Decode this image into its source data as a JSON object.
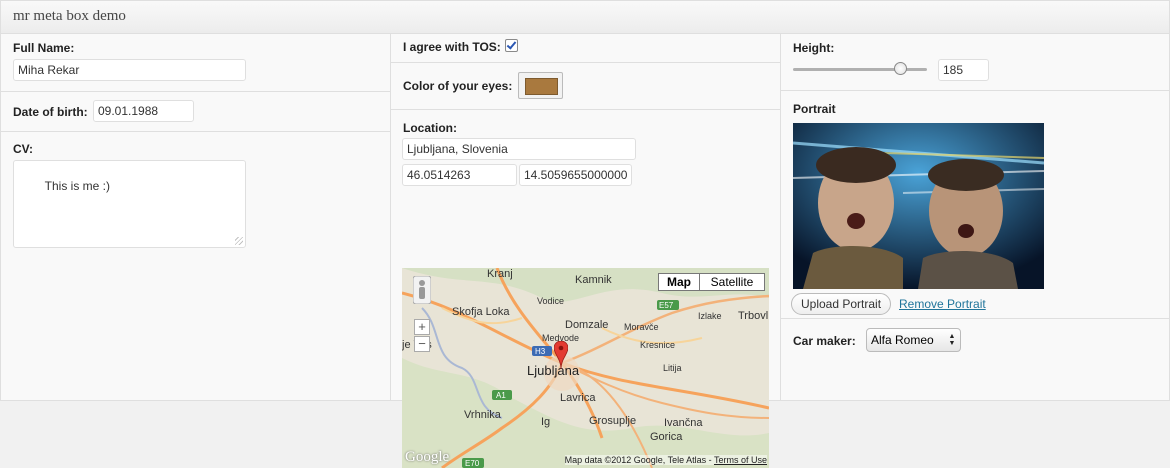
{
  "title": "mr meta box demo",
  "col1": {
    "full_name_label": "Full Name:",
    "full_name_value": "Miha Rekar",
    "dob_label": "Date of birth:",
    "dob_value": "09.01.1988",
    "cv_label": "CV:",
    "cv_value": "This is me :)"
  },
  "col2": {
    "tos_label": "I agree with TOS:",
    "tos_checked": true,
    "eyes_label": "Color of your eyes:",
    "eyes_color": "#a9793e",
    "location_label": "Location:",
    "location_value": "Ljubljana, Slovenia",
    "lat_value": "46.0514263",
    "lng_value": "14.5059655000000",
    "map": {
      "map_button": "Map",
      "satellite_button": "Satellite",
      "zoom_in": "+",
      "zoom_out": "−",
      "attribution": "Map data ©2012 Google, Tele Atlas - ",
      "terms": "Terms of Use",
      "google_logo": "Google",
      "places": {
        "kranj": "Kranj",
        "kamnik": "Kamnik",
        "vodice": "Vodice",
        "skofja": "Skofja Loka",
        "domzale": "Domzale",
        "izlake": "Izlake",
        "trbovlje": "Trbovl",
        "moravce": "Moravče",
        "medvode": "Medvode",
        "polhov": "je Vas",
        "kresnice": "Kresnice",
        "ljubljana": "Ljubljana",
        "litija": "Litija",
        "lavrica": "Lavrica",
        "vrhnika": "Vrhnika",
        "ig": "Ig",
        "grosuplje": "Grosuplje",
        "ivancna": "Ivančna",
        "gorica": "Gorica"
      },
      "shields": {
        "e57": "E57",
        "h3": "H3",
        "a1": "A1",
        "e70": "E70"
      }
    }
  },
  "col3": {
    "height_label": "Height:",
    "height_value": "185",
    "height_fraction": 0.8,
    "portrait_label": "Portrait",
    "upload_button": "Upload Portrait",
    "remove_link": "Remove Portrait",
    "car_label": "Car maker:",
    "car_value": "Alfa Romeo"
  }
}
